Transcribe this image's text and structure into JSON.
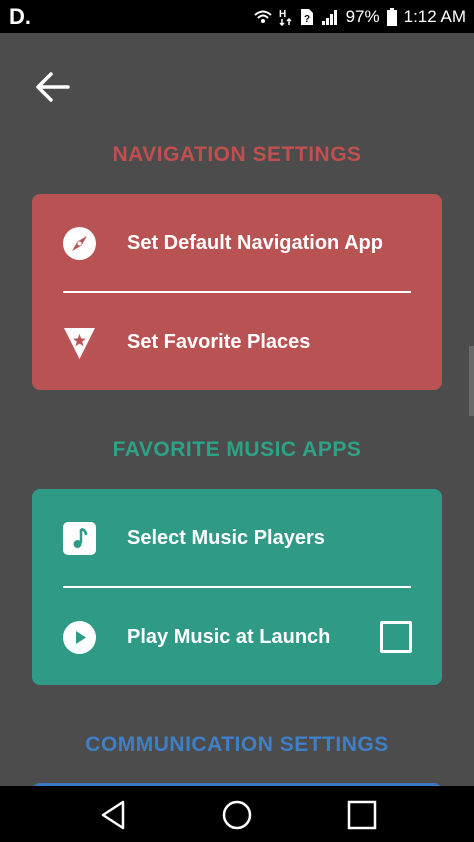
{
  "status_bar": {
    "brand": "D.",
    "battery_percent": "97%",
    "time": "1:12 AM",
    "icons": [
      "wifi-icon",
      "data-arrows-icon",
      "no-sim-icon",
      "signal-icon",
      "battery-icon"
    ]
  },
  "header": {
    "back_icon": "arrow-left-icon"
  },
  "sections": {
    "navigation": {
      "title": "NAVIGATION SETTINGS",
      "color": "#c0504f",
      "card_color": "#b95353",
      "items": [
        {
          "label": "Set Default Navigation App",
          "icon": "compass-icon"
        },
        {
          "label": "Set Favorite Places",
          "icon": "star-pin-icon"
        }
      ]
    },
    "music": {
      "title": "FAVORITE MUSIC APPS",
      "color": "#2ea287",
      "card_color": "#2f9a85",
      "items": [
        {
          "label": "Select Music Players",
          "icon": "music-note-icon"
        },
        {
          "label": "Play Music at Launch",
          "icon": "play-icon",
          "checked": false
        }
      ]
    },
    "communication": {
      "title": "COMMUNICATION SETTINGS",
      "color": "#3f7fc6"
    }
  },
  "nav_bar": {
    "buttons": [
      "back-triangle-icon",
      "home-circle-icon",
      "recents-square-icon"
    ]
  }
}
